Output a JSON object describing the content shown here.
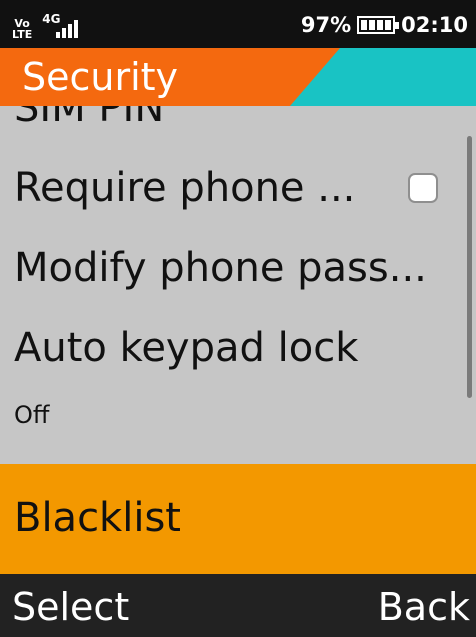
{
  "status_bar": {
    "volte_top": "Vo",
    "volte_bottom": "LTE",
    "network": "4G",
    "battery": "97%",
    "time": "02:10"
  },
  "header": {
    "title": "Security"
  },
  "menu": {
    "items": [
      {
        "label": "SIM PIN"
      },
      {
        "label": "Require phone ...",
        "checked": false
      },
      {
        "label": "Modify phone pass..."
      },
      {
        "label": "Auto keypad lock",
        "value": "Off"
      },
      {
        "label": "Blacklist",
        "selected": true
      }
    ]
  },
  "softkeys": {
    "left": "Select",
    "right": "Back"
  },
  "colors": {
    "header_orange": "#f4690f",
    "header_teal": "#19c3c4",
    "selection": "#f39800",
    "list_bg": "#c6c6c6"
  },
  "icons": [
    "volte-icon",
    "signal-4g-icon",
    "battery-icon",
    "checkbox-icon"
  ]
}
